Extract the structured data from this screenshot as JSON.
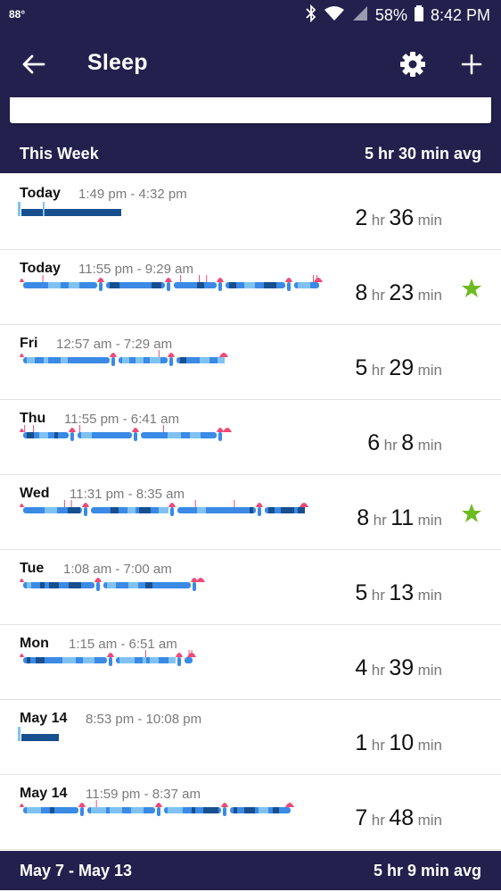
{
  "status_bar": {
    "temperature": "88°",
    "battery": "58%",
    "time": "8:42 PM",
    "icons": [
      "bluetooth-icon",
      "wifi-icon",
      "signal-icon",
      "battery-icon"
    ]
  },
  "app_bar": {
    "title": "Sleep",
    "icons": [
      "back-arrow-icon",
      "gear-icon",
      "plus-icon"
    ]
  },
  "colors": {
    "header": "#23204d",
    "deep": "#174f8f",
    "light": "#3a8ae6",
    "rem": "#7fc2f2",
    "awake": "#ef4a78",
    "star": "#6dbb21"
  },
  "sections": [
    {
      "label": "This Week",
      "avg": "5 hr 30 min avg",
      "rows": [
        {
          "day": "Today",
          "time": "1:49 pm - 4:32 pm",
          "hr": "2",
          "min": "36",
          "star": false,
          "bar": "classic"
        },
        {
          "day": "Today",
          "time": "11:55 pm - 9:29 am",
          "hr": "8",
          "min": "23",
          "star": true,
          "bar": "stages"
        },
        {
          "day": "Fri",
          "time": "12:57 am - 7:29 am",
          "hr": "5",
          "min": "29",
          "star": false,
          "bar": "stages"
        },
        {
          "day": "Thu",
          "time": "11:55 pm - 6:41 am",
          "hr": "6",
          "min": "8",
          "star": false,
          "bar": "stages"
        },
        {
          "day": "Wed",
          "time": "11:31 pm - 8:35 am",
          "hr": "8",
          "min": "11",
          "star": true,
          "bar": "stages"
        },
        {
          "day": "Tue",
          "time": "1:08 am - 7:00 am",
          "hr": "5",
          "min": "13",
          "star": false,
          "bar": "stages"
        },
        {
          "day": "Mon",
          "time": "1:15 am - 6:51 am",
          "hr": "4",
          "min": "39",
          "star": false,
          "bar": "stages"
        },
        {
          "day": "May 14",
          "time": "8:53 pm - 10:08 pm",
          "hr": "1",
          "min": "10",
          "star": false,
          "bar": "classic"
        },
        {
          "day": "May 14",
          "time": "11:59 pm - 8:37 am",
          "hr": "7",
          "min": "48",
          "star": false,
          "bar": "stages"
        }
      ]
    },
    {
      "label": "May 7 - May 13",
      "avg": "5 hr 9 min avg"
    }
  ],
  "units": {
    "hr": "hr",
    "min": "min"
  }
}
